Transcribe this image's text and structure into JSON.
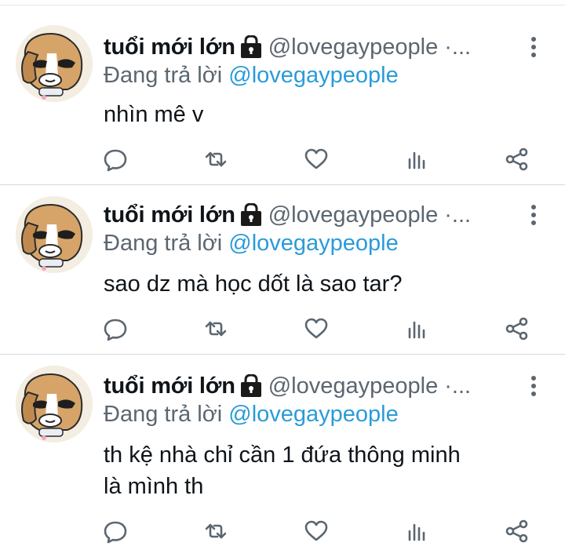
{
  "tweets": [
    {
      "display_name": "tuổi mới lớn",
      "handle_meta": "@lovegaypeople ·...",
      "reply_prefix": "Đang trả lời",
      "reply_handle": "@lovegaypeople",
      "text_lines": [
        "nhìn mê v"
      ]
    },
    {
      "display_name": "tuổi mới lớn",
      "handle_meta": "@lovegaypeople ·...",
      "reply_prefix": "Đang trả lời",
      "reply_handle": "@lovegaypeople",
      "text_lines": [
        "sao dz mà học dốt là sao tar?"
      ]
    },
    {
      "display_name": "tuổi mới lớn",
      "handle_meta": "@lovegaypeople ·...",
      "reply_prefix": "Đang trả lời",
      "reply_handle": "@lovegaypeople",
      "text_lines": [
        "th kệ nhà chỉ cần 1 đứa thông minh",
        "là mình th"
      ]
    }
  ],
  "icons": {
    "lock": "lock-icon",
    "more": "more-vertical-icon",
    "actions": [
      "reply-icon",
      "retweet-icon",
      "like-icon",
      "analytics-icon",
      "share-icon"
    ]
  },
  "colors": {
    "text": "#0f1419",
    "secondary": "#5b6670",
    "link": "#2a9bd8",
    "icon": "#5b6670",
    "divider": "#d4d9de"
  }
}
